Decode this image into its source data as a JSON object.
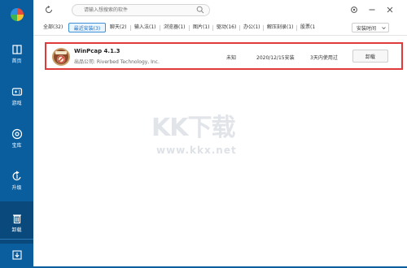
{
  "sidebar": {
    "items": [
      {
        "label": "首页",
        "icon": "home-icon"
      },
      {
        "label": "游戏",
        "icon": "gamepad-icon"
      },
      {
        "label": "宝库",
        "icon": "treasure-icon"
      },
      {
        "label": "升级",
        "icon": "upgrade-icon"
      },
      {
        "label": "卸载",
        "icon": "trash-icon"
      }
    ],
    "bottom_icon": "download-icon"
  },
  "search": {
    "placeholder": "请输入想搜索的软件"
  },
  "tabs": [
    {
      "label": "全部(32)"
    },
    {
      "label": "最近安装(3)"
    },
    {
      "label": "聊天(2)"
    },
    {
      "label": "输入法(1)"
    },
    {
      "label": "浏览器(1)"
    },
    {
      "label": "图片(1)"
    },
    {
      "label": "驱动(16)"
    },
    {
      "label": "办公(1)"
    },
    {
      "label": "解压刻录(1)"
    },
    {
      "label": "股票(1"
    }
  ],
  "sort": {
    "label": "安装时间"
  },
  "app": {
    "name": "WinPcap 4.1.3",
    "publisher": "出品公司: Riverbed Technology, Inc.",
    "size": "未知",
    "date": "2020/12/15安装",
    "usage": "3天内使用过",
    "uninstall_label": "卸载"
  },
  "watermark": {
    "brand": "KK下载",
    "site": "www.kkx.net"
  },
  "colors": {
    "sidebar": "#0b5e9e",
    "active": "#09497c",
    "accent": "#1a73c7",
    "highlight_border": "#e03b3b"
  }
}
